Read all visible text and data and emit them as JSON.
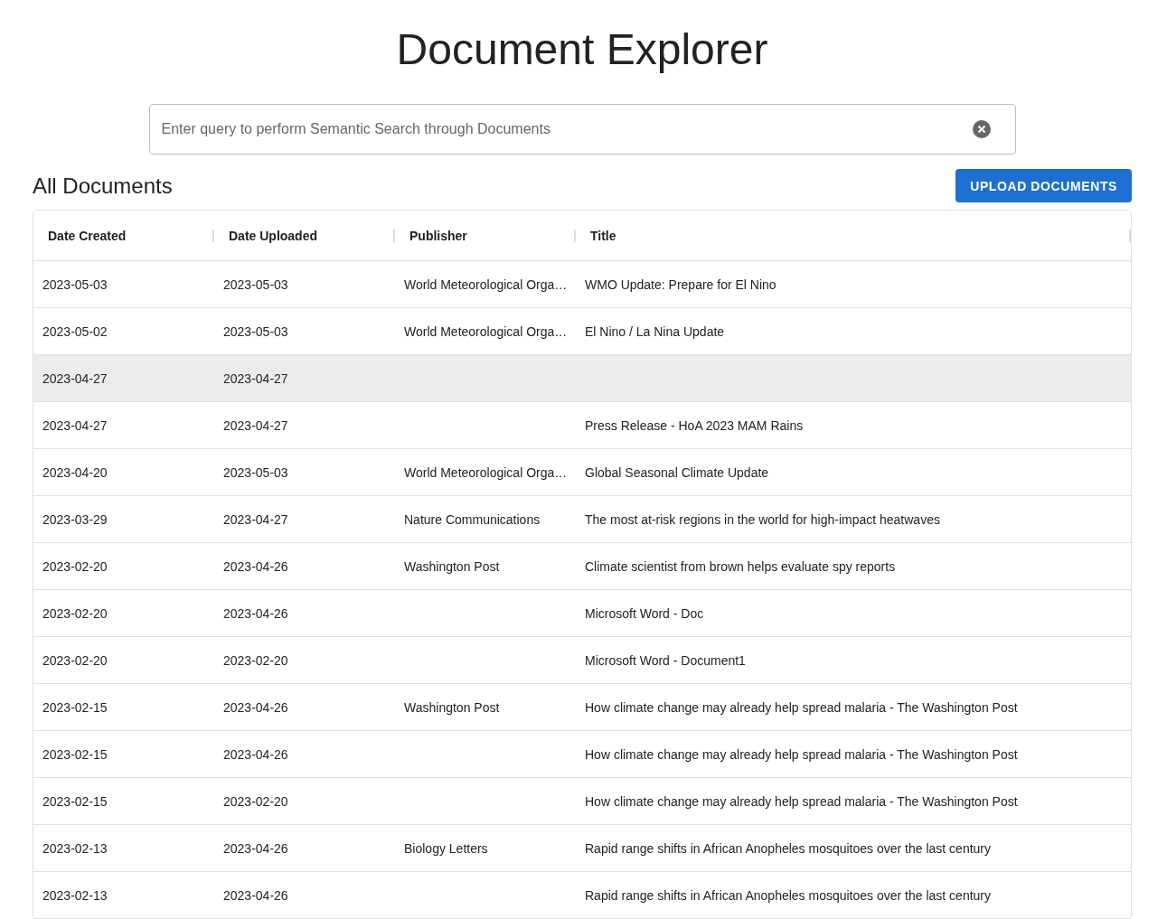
{
  "page_title": "Document Explorer",
  "search": {
    "placeholder": "Enter query to perform Semantic Search through Documents"
  },
  "section": {
    "heading": "All Documents",
    "upload_button": "UPLOAD DOCUMENTS"
  },
  "table": {
    "columns": [
      "Date Created",
      "Date Uploaded",
      "Publisher",
      "Title"
    ],
    "rows": [
      {
        "date_created": "2023-05-03",
        "date_uploaded": "2023-05-03",
        "publisher": "World Meteorological Orga…",
        "title": "WMO Update: Prepare for El Nino",
        "selected": false
      },
      {
        "date_created": "2023-05-02",
        "date_uploaded": "2023-05-03",
        "publisher": "World Meteorological Orga…",
        "title": "El Nino / La Nina Update",
        "selected": false
      },
      {
        "date_created": "2023-04-27",
        "date_uploaded": "2023-04-27",
        "selected": true
      },
      {
        "date_created": "2023-04-27",
        "date_uploaded": "2023-04-27",
        "title": "Press Release - HoA 2023 MAM Rains",
        "selected": false
      },
      {
        "date_created": "2023-04-20",
        "date_uploaded": "2023-05-03",
        "publisher": "World Meteorological Orga…",
        "title": "Global Seasonal Climate Update",
        "selected": false
      },
      {
        "date_created": "2023-03-29",
        "date_uploaded": "2023-04-27",
        "publisher": "Nature Communications",
        "title": "The most at-risk regions in the world for high-impact heatwaves",
        "selected": false
      },
      {
        "date_created": "2023-02-20",
        "date_uploaded": "2023-04-26",
        "publisher": "Washington Post",
        "title": "Climate scientist from brown helps evaluate spy reports",
        "selected": false
      },
      {
        "date_created": "2023-02-20",
        "date_uploaded": "2023-04-26",
        "title": "Microsoft Word - Doc",
        "selected": false
      },
      {
        "date_created": "2023-02-20",
        "date_uploaded": "2023-02-20",
        "title": "Microsoft Word - Document1",
        "selected": false
      },
      {
        "date_created": "2023-02-15",
        "date_uploaded": "2023-04-26",
        "publisher": "Washington Post",
        "title": "How climate change may already help spread malaria - The Washington Post",
        "selected": false
      },
      {
        "date_created": "2023-02-15",
        "date_uploaded": "2023-04-26",
        "title": "How climate change may already help spread malaria - The Washington Post",
        "selected": false
      },
      {
        "date_created": "2023-02-15",
        "date_uploaded": "2023-02-20",
        "title": "How climate change may already help spread malaria - The Washington Post",
        "selected": false
      },
      {
        "date_created": "2023-02-13",
        "date_uploaded": "2023-04-26",
        "publisher": "Biology Letters",
        "title": "Rapid range shifts in African Anopheles mosquitoes over the last century",
        "selected": false
      },
      {
        "date_created": "2023-02-13",
        "date_uploaded": "2023-04-26",
        "title": "Rapid range shifts in African Anopheles mosquitoes over the last century",
        "selected": false
      }
    ]
  }
}
